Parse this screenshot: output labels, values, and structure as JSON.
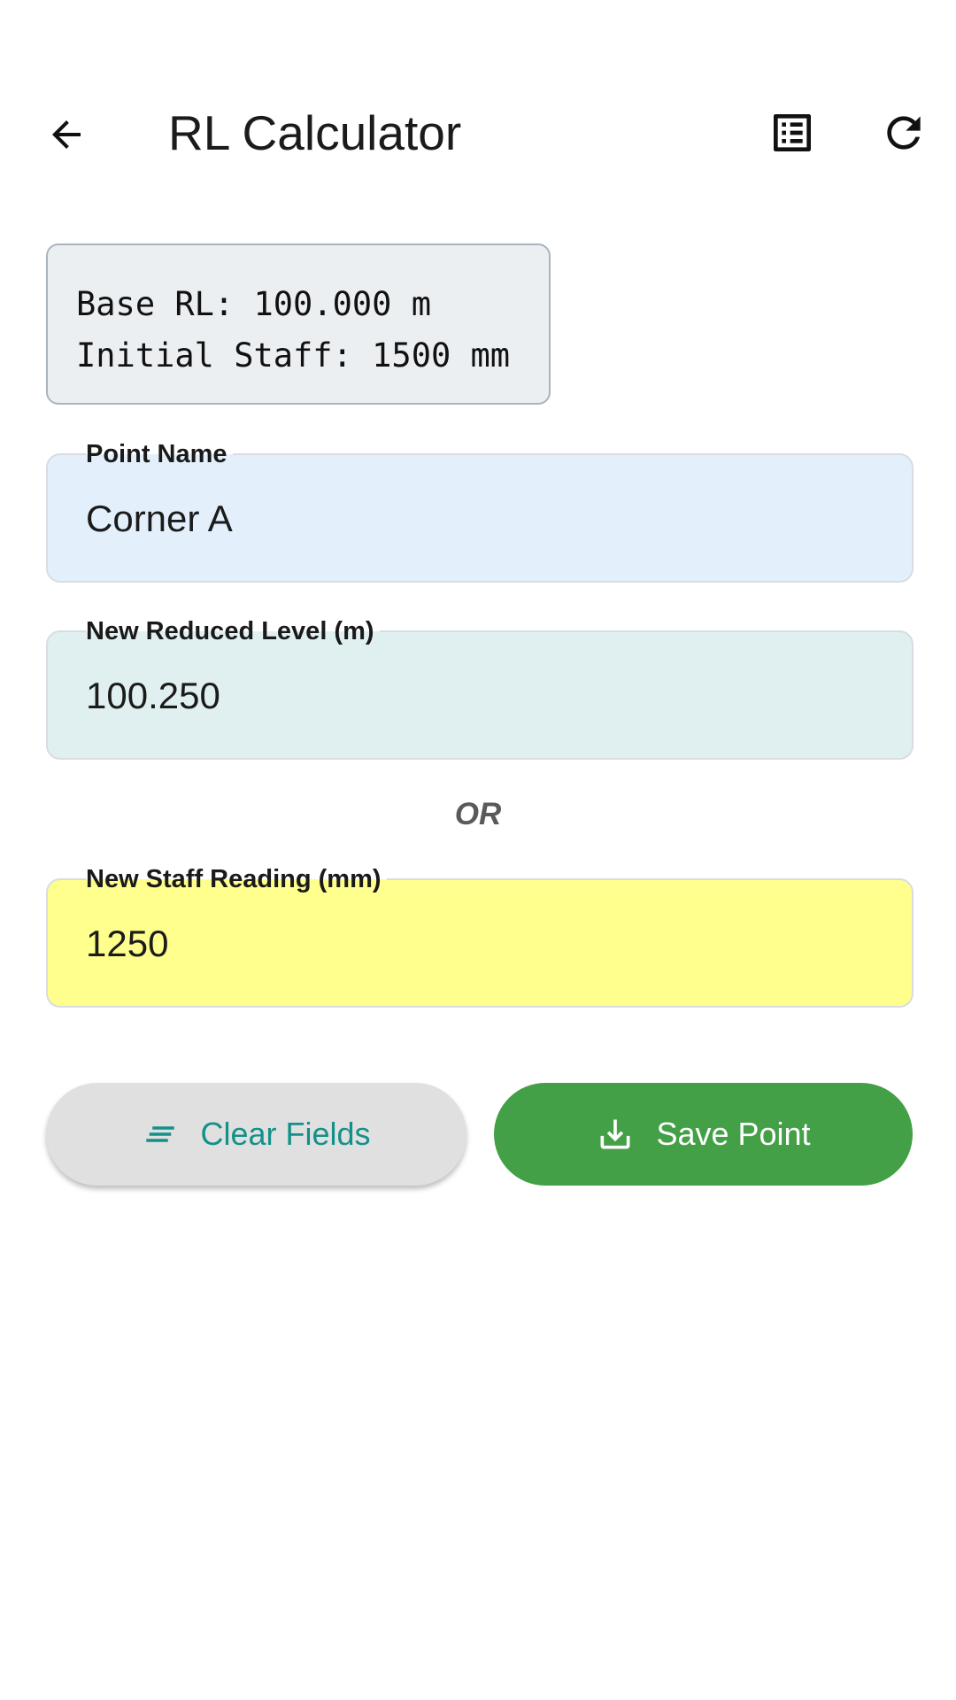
{
  "appbar": {
    "title": "RL Calculator",
    "back_icon": "arrow-back-icon",
    "list_icon": "list-alt-icon",
    "refresh_icon": "refresh-icon"
  },
  "info": {
    "base_rl": "Base RL: 100.000 m",
    "initial_staff": "Initial Staff: 1500 mm"
  },
  "form": {
    "point_name": {
      "label": "Point Name",
      "value": "Corner A"
    },
    "reduced_level": {
      "label": "New Reduced Level (m)",
      "value": "100.250"
    },
    "separator": "OR",
    "staff_reading": {
      "label": "New Staff Reading (mm)",
      "value": "1250"
    }
  },
  "actions": {
    "clear_label": "Clear Fields",
    "clear_icon": "clear-all-icon",
    "save_label": "Save Point",
    "save_icon": "download-icon"
  },
  "colors": {
    "point_name_bg": "#e3f0fc",
    "reduced_level_bg": "#e0f0f0",
    "staff_reading_bg": "#ffff8d",
    "save_button": "#43a047",
    "clear_button": "#e0e0e0",
    "clear_text": "#14908a"
  }
}
